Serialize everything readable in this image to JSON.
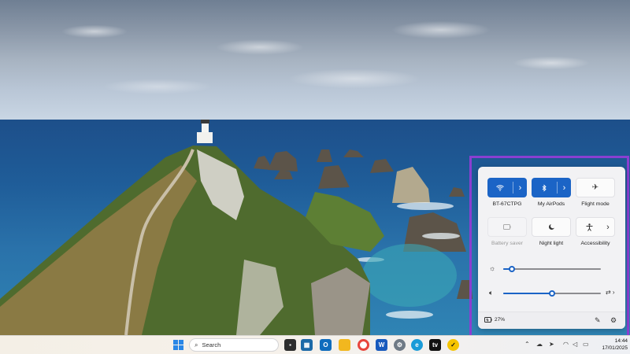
{
  "quick_settings": {
    "tiles": [
      {
        "label": "BT-67CTPG",
        "icon": "wifi-icon",
        "state": "on",
        "has_arrow": true
      },
      {
        "label": "My AirPods",
        "icon": "bluetooth-icon",
        "state": "on",
        "has_arrow": true
      },
      {
        "label": "Flight mode",
        "icon": "airplane-icon",
        "state": "off",
        "has_arrow": false
      },
      {
        "label": "Battery saver",
        "icon": "battery-saver-icon",
        "state": "disabled",
        "has_arrow": false
      },
      {
        "label": "Night light",
        "icon": "night-light-icon",
        "state": "off",
        "has_arrow": false
      },
      {
        "label": "Accessibility",
        "icon": "accessibility-icon",
        "state": "off",
        "has_arrow": true
      }
    ],
    "brightness_level": 0.09,
    "volume_level": 0.5,
    "battery_text": "27%",
    "accent_color": "#1b64c6"
  },
  "taskbar": {
    "search_placeholder": "Search",
    "apps": [
      "file-manager-icon",
      "store-icon",
      "outlook-icon",
      "file-explorer-icon",
      "chrome-icon",
      "word-icon",
      "settings-icon",
      "edge-icon",
      "apple-tv-icon",
      "norton-icon"
    ],
    "clock_time": "14:44",
    "clock_date": "17/01/2025"
  },
  "highlight_color": "#8a3fd1"
}
